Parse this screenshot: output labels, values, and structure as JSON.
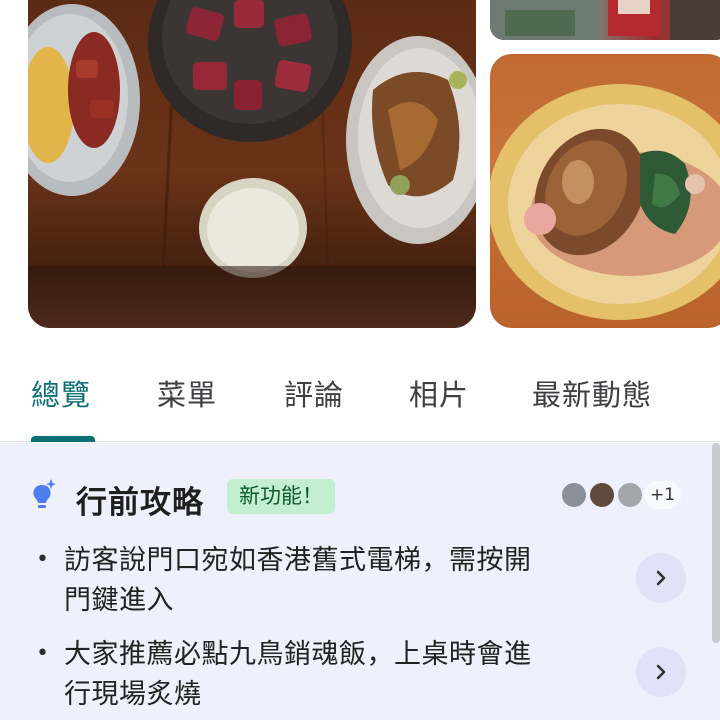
{
  "gallery": {
    "main_photo": "dishes-on-wooden-table",
    "top_right_photo": "restaurant-storefront",
    "side_photo": "abalone-in-bowl"
  },
  "tabs": [
    {
      "label": "總覽",
      "active": true
    },
    {
      "label": "菜單",
      "active": false
    },
    {
      "label": "評論",
      "active": false
    },
    {
      "label": "相片",
      "active": false
    },
    {
      "label": "最新動態",
      "active": false
    }
  ],
  "tips": {
    "title": "行前攻略",
    "badge": "新功能！",
    "icon": "lightbulb-sparkle-icon",
    "contributors_more": "+1",
    "items": [
      {
        "line1": "訪客說門口宛如香港舊式電梯，需按開",
        "line2": "門鍵進入"
      },
      {
        "line1": "大家推薦必點九鳥銷魂飯，上桌時會進",
        "line2": "行現場炙燒"
      }
    ]
  },
  "colors": {
    "accent": "#0d6f76",
    "panel_bg": "#eef0fc",
    "badge_bg": "#c4eed0",
    "badge_text": "#0d5a2b"
  }
}
